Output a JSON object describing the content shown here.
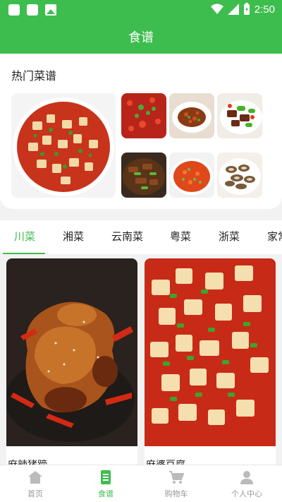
{
  "status_bar": {
    "time": "2:50"
  },
  "app_bar": {
    "title": "食谱"
  },
  "hot": {
    "title": "热门菜谱",
    "dishes": [
      "mapo-tofu",
      "chili-fish",
      "kung-pao",
      "pepper-beef",
      "stir-fry-beef",
      "chopped-pepper",
      "mushroom-slices"
    ]
  },
  "tabs": [
    {
      "label": "川菜",
      "active": true
    },
    {
      "label": "湘菜"
    },
    {
      "label": "云南菜"
    },
    {
      "label": "粤菜"
    },
    {
      "label": "浙菜"
    },
    {
      "label": "家常"
    }
  ],
  "recipes": [
    {
      "name": "麻辣猪蹄"
    },
    {
      "name": "麻婆豆腐"
    }
  ],
  "nav": [
    {
      "label": "首页",
      "icon": "home-icon"
    },
    {
      "label": "食谱",
      "icon": "recipe-icon",
      "active": true
    },
    {
      "label": "购物车",
      "icon": "cart-icon"
    },
    {
      "label": "个人中心",
      "icon": "person-icon"
    }
  ],
  "colors": {
    "primary": "#3dbd4e",
    "inactive": "#999999"
  }
}
